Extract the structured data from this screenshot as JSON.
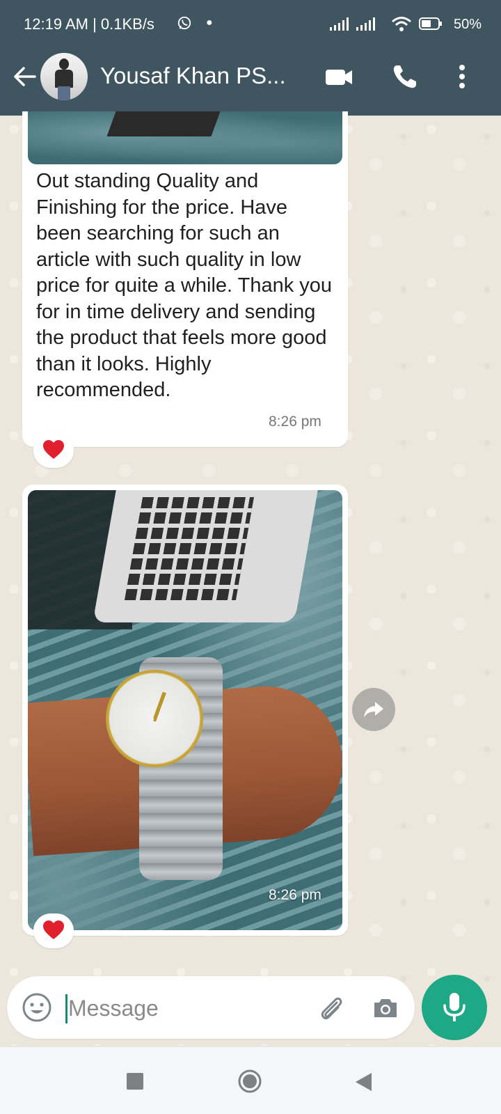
{
  "status_bar": {
    "time": "12:19 AM | 0.1KB/s",
    "battery": "50%"
  },
  "header": {
    "contact_name": "Yousaf Khan PS..."
  },
  "messages": [
    {
      "text": "Out standing Quality and Finishing for the price. Have been searching for such an article with such quality in low price for quite a while. Thank you for in time delivery and sending the product that feels more good than it looks. Highly recommended.",
      "time": "8:26 pm",
      "reaction": "heart"
    },
    {
      "type": "photo",
      "time": "8:26 pm",
      "reaction": "heart"
    }
  ],
  "composer": {
    "placeholder": "Message"
  },
  "colors": {
    "header": "#3F5560",
    "mic_button": "#1FA885",
    "chat_background": "#EDE6DD",
    "reaction": "#E0202C"
  },
  "icons": {
    "back": "back-arrow-icon",
    "video": "video-call-icon",
    "call": "phone-icon",
    "menu": "more-vert-icon",
    "emoji": "emoji-icon",
    "attach": "paperclip-icon",
    "camera": "camera-icon",
    "mic": "mic-icon",
    "forward": "forward-icon"
  }
}
